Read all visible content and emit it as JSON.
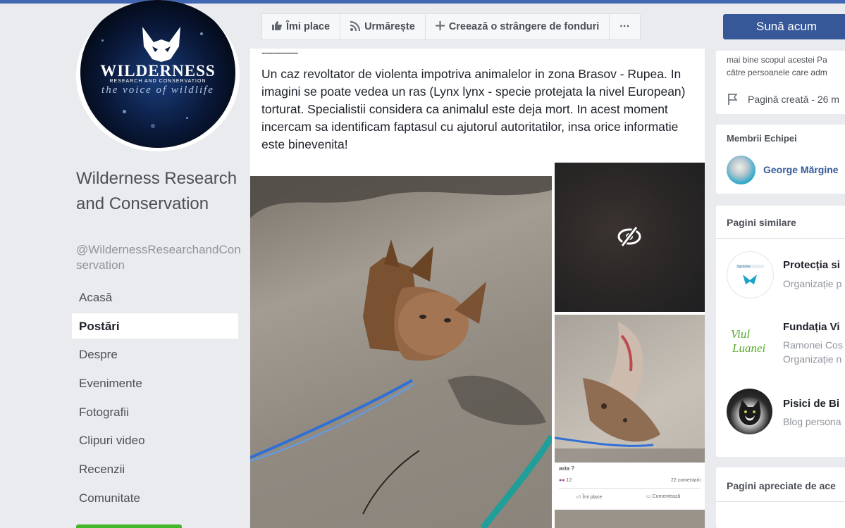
{
  "page": {
    "name": "Wilderness Research and Conservation",
    "handle": "@WildernessResearchandConservation",
    "logo": {
      "title": "WILDERNESS",
      "subtitle": "RESEARCH AND CONSERVATION",
      "tagline": "the voice of wildlife"
    }
  },
  "nav": {
    "items": [
      {
        "label": "Acasă",
        "active": false
      },
      {
        "label": "Postări",
        "active": true
      },
      {
        "label": "Despre",
        "active": false
      },
      {
        "label": "Evenimente",
        "active": false
      },
      {
        "label": "Fotografii",
        "active": false
      },
      {
        "label": "Clipuri video",
        "active": false
      },
      {
        "label": "Recenzii",
        "active": false
      },
      {
        "label": "Comunitate",
        "active": false
      }
    ]
  },
  "actions": {
    "like": "Îmi place",
    "follow": "Urmărește",
    "fundraiser": "Creează o strângere de fonduri",
    "more": "···"
  },
  "post": {
    "divider": "--------------",
    "text": "Un caz revoltator de violenta impotriva animalelor in zona Brasov - Rupea. In imagini se poate vedea un ras (Lynx lynx - specie protejata la nivel European) torturat. Specialistii considera ca animalul este deja mort. In acest moment incercam sa identificam faptasul cu ajutorul autoritatilor, insa orice informatie este binevenita!",
    "embedded": {
      "question": "asta ?",
      "reactions": "12",
      "comments": "22 comentarii",
      "like": "Îmi place",
      "comment": "Comentează"
    }
  },
  "sidebar": {
    "cta": "Sună acum",
    "about": {
      "line1": "mai bine scopul acestei Pa",
      "line2": "către persoanele care adm",
      "created": "Pagină creată - 26 m"
    },
    "team": {
      "title": "Membrii Echipei",
      "member": "George Mărgine"
    },
    "similar": {
      "title": "Pagini similare",
      "items": [
        {
          "name": "Protecția si",
          "sub1": "Organizație p",
          "sub2": "",
          "logo_text": "Spreolor"
        },
        {
          "name": "Fundația Vi",
          "sub1": "Ramonei Cos",
          "sub2": "Organizație n",
          "logo_text": "Viu Luanei"
        },
        {
          "name": "Pisici de Bi",
          "sub1": "Blog persona",
          "sub2": "",
          "logo_text": ""
        }
      ]
    },
    "liked": {
      "title": "Pagini apreciate de ace"
    }
  },
  "colors": {
    "facebook_blue": "#4267b2",
    "cta_blue": "#365899",
    "background": "#e9ebee"
  }
}
